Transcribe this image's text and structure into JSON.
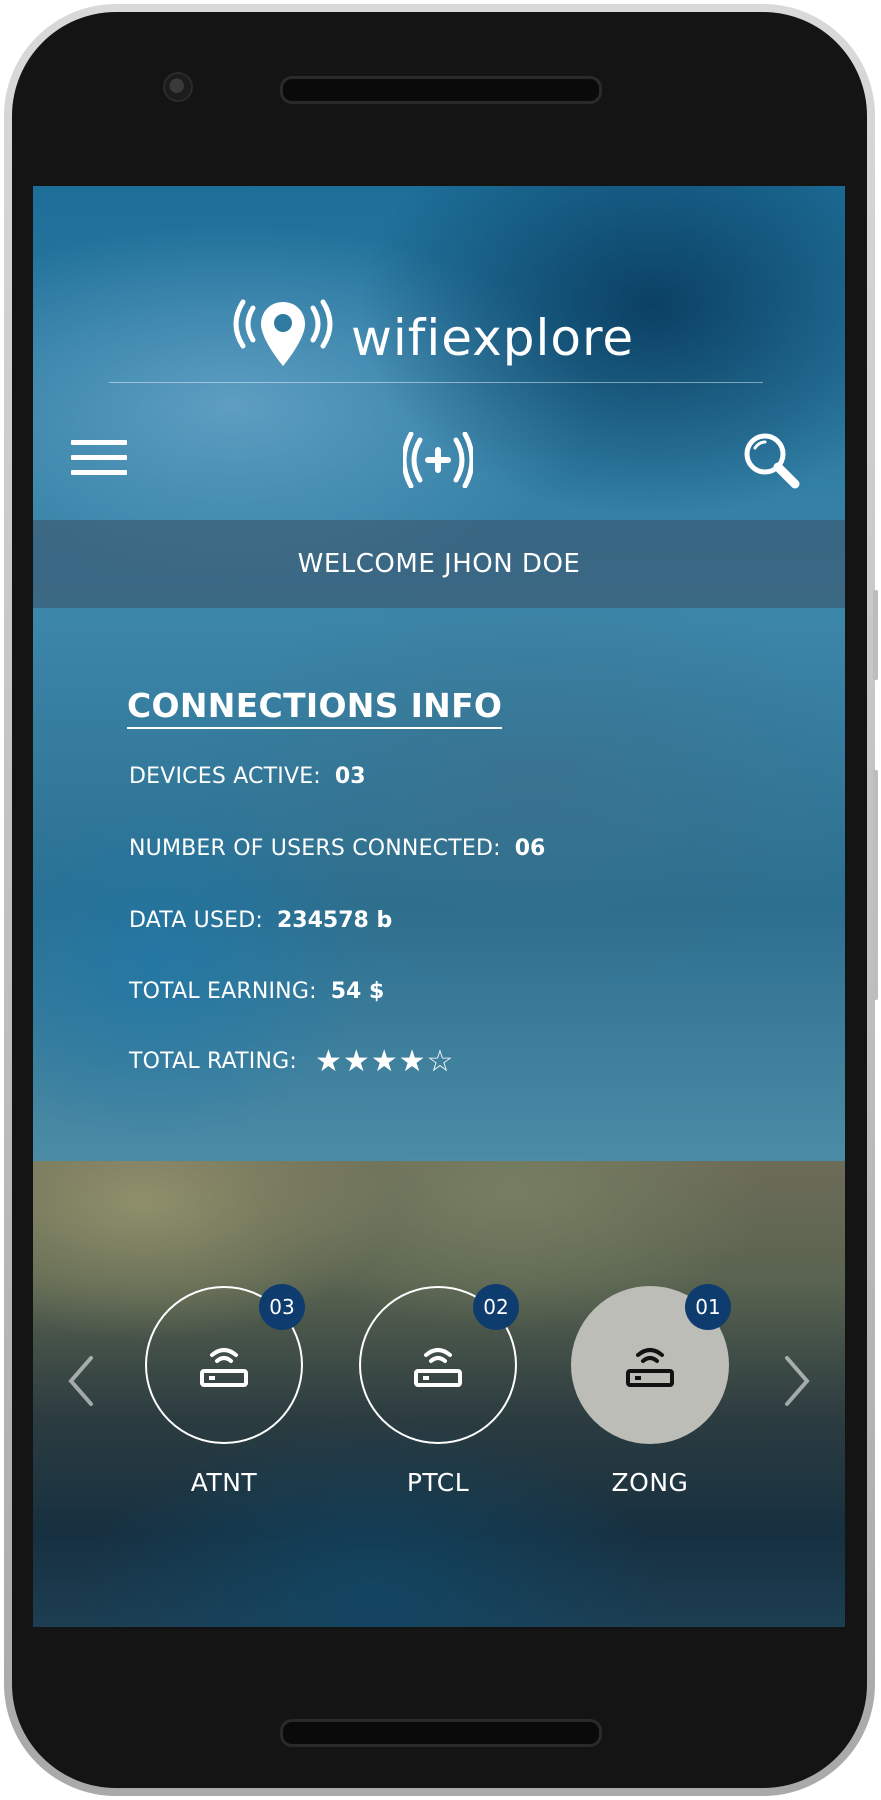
{
  "app": {
    "name": "wifiexplore"
  },
  "welcome": {
    "text": "WELCOME JHON DOE"
  },
  "connections_info": {
    "title": "CONNECTIONS INFO",
    "rows": [
      {
        "label": "DEVICES ACTIVE:",
        "value": "03"
      },
      {
        "label": "NUMBER OF USERS CONNECTED:",
        "value": "06"
      },
      {
        "label": "DATA USED:",
        "value": "234578 b"
      },
      {
        "label": "TOTAL EARNING:",
        "value": "54 $"
      }
    ],
    "rating": {
      "label": "TOTAL RATING:",
      "stars_text": "★★★★☆",
      "value": 4,
      "max": 5
    }
  },
  "networks": [
    {
      "name": "ATNT",
      "count": "03",
      "selected": false
    },
    {
      "name": "PTCL",
      "count": "02",
      "selected": false
    },
    {
      "name": "ZONG",
      "count": "01",
      "selected": true
    }
  ],
  "icons": {
    "logo": "wifi-location-pin-icon",
    "menu": "hamburger-menu-icon",
    "add_wifi": "add-wifi-icon",
    "search": "search-icon",
    "router": "router-icon",
    "prev": "chevron-left-icon",
    "next": "chevron-right-icon"
  },
  "colors": {
    "badge": "#0e3c6e",
    "selected_circle": "#bdbdb7",
    "text": "#ffffff"
  }
}
